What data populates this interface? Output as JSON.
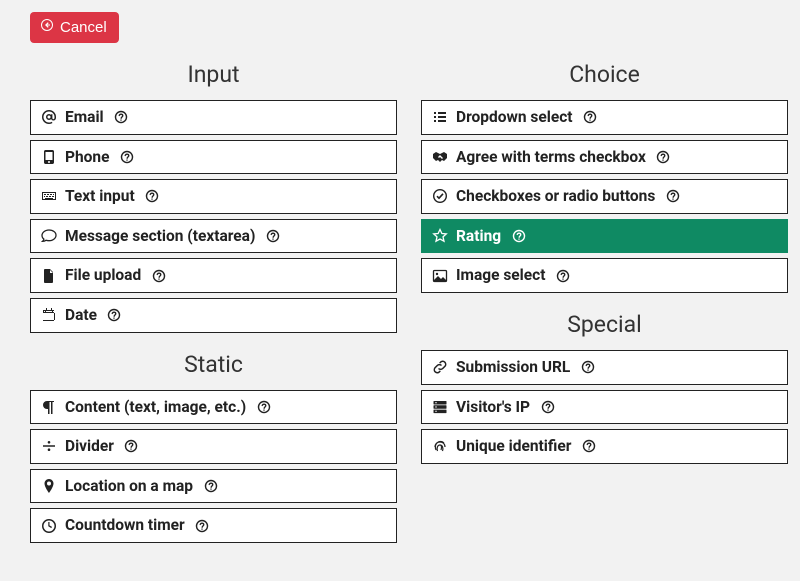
{
  "topbar": {
    "cancel_label": "Cancel"
  },
  "columns": {
    "left": [
      {
        "title": "Input",
        "items": [
          {
            "icon": "at",
            "label": "Email"
          },
          {
            "icon": "phone",
            "label": "Phone"
          },
          {
            "icon": "keyboard",
            "label": "Text input"
          },
          {
            "icon": "comment",
            "label": "Message section (textarea)"
          },
          {
            "icon": "file",
            "label": "File upload"
          },
          {
            "icon": "calendar",
            "label": "Date"
          }
        ]
      },
      {
        "title": "Static",
        "items": [
          {
            "icon": "paragraph",
            "label": "Content (text, image, etc.)"
          },
          {
            "icon": "divide",
            "label": "Divider"
          },
          {
            "icon": "map-marker",
            "label": "Location on a map"
          },
          {
            "icon": "clock",
            "label": "Countdown timer"
          }
        ]
      }
    ],
    "right": [
      {
        "title": "Choice",
        "items": [
          {
            "icon": "list",
            "label": "Dropdown select"
          },
          {
            "icon": "handshake",
            "label": "Agree with terms checkbox"
          },
          {
            "icon": "check-circle",
            "label": "Checkboxes or radio buttons"
          },
          {
            "icon": "star",
            "label": "Rating",
            "active": true
          },
          {
            "icon": "image",
            "label": "Image select"
          }
        ]
      },
      {
        "title": "Special",
        "items": [
          {
            "icon": "link",
            "label": "Submission URL"
          },
          {
            "icon": "server",
            "label": "Visitor's IP"
          },
          {
            "icon": "fingerprint",
            "label": "Unique identifier"
          }
        ]
      }
    ]
  }
}
